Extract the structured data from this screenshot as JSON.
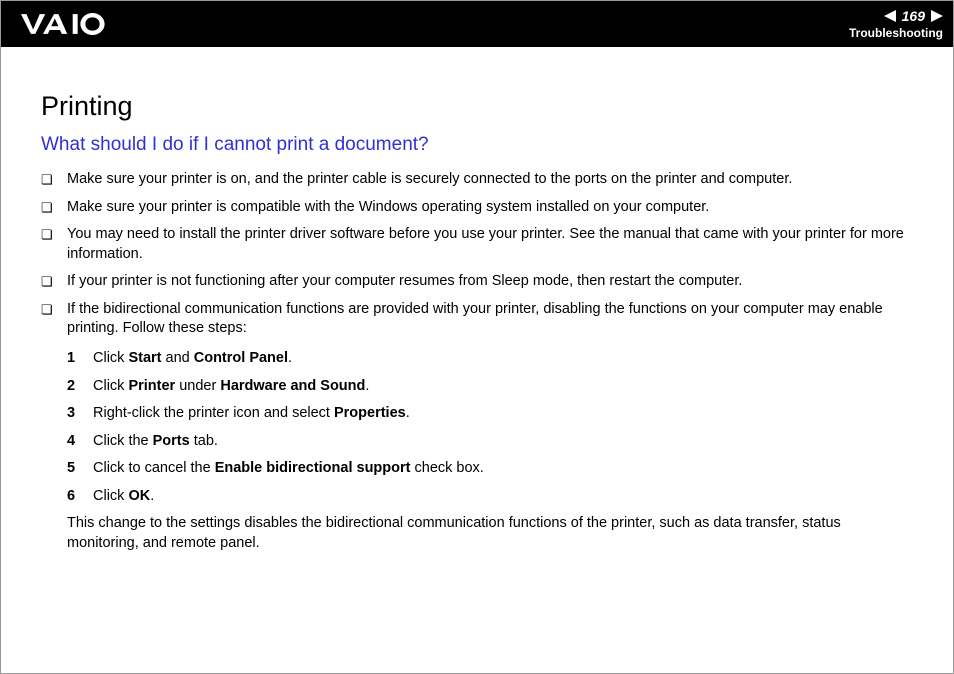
{
  "header": {
    "page_number": "169",
    "section": "Troubleshooting"
  },
  "title": "Printing",
  "subtitle": "What should I do if I cannot print a document?",
  "bullets": {
    "b1": "Make sure your printer is on, and the printer cable is securely connected to the ports on the printer and computer.",
    "b2": "Make sure your printer is compatible with the Windows operating system installed on your computer.",
    "b3": "You may need to install the printer driver software before you use your printer. See the manual that came with your printer for more information.",
    "b4": "If your printer is not functioning after your computer resumes from Sleep mode, then restart the computer.",
    "b5": "If the bidirectional communication functions are provided with your printer, disabling the functions on your computer may enable printing. Follow these steps:"
  },
  "steps": {
    "s1_a": "Click ",
    "s1_b": "Start",
    "s1_c": " and ",
    "s1_d": "Control Panel",
    "s1_e": ".",
    "s2_a": "Click ",
    "s2_b": "Printer",
    "s2_c": " under ",
    "s2_d": "Hardware and Sound",
    "s2_e": ".",
    "s3_a": "Right-click the printer icon and select ",
    "s3_b": "Properties",
    "s3_c": ".",
    "s4_a": "Click the ",
    "s4_b": "Ports",
    "s4_c": " tab.",
    "s5_a": "Click to cancel the ",
    "s5_b": "Enable bidirectional support",
    "s5_c": " check box.",
    "s6_a": "Click ",
    "s6_b": "OK",
    "s6_c": "."
  },
  "trailing": "This change to the settings disables the bidirectional communication functions of the printer, such as data transfer, status monitoring, and remote panel.",
  "nums": {
    "n1": "1",
    "n2": "2",
    "n3": "3",
    "n4": "4",
    "n5": "5",
    "n6": "6"
  },
  "bullet_marker": "❏"
}
